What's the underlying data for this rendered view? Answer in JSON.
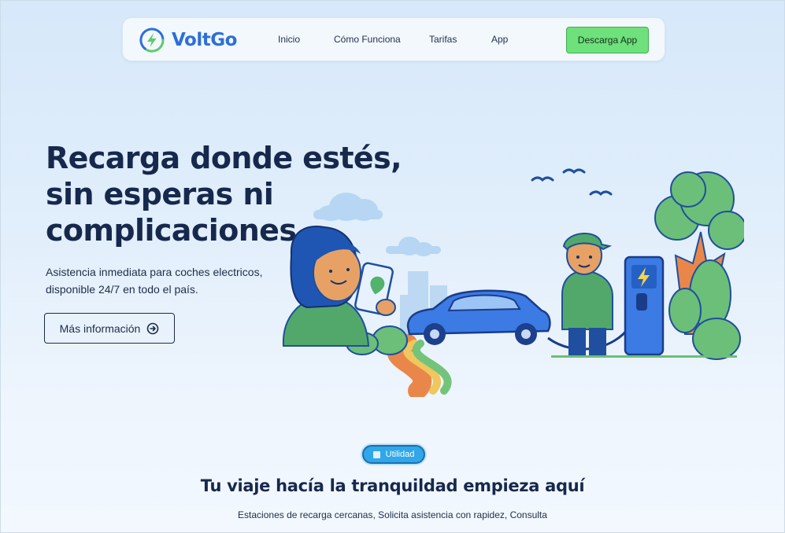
{
  "nav": {
    "brand": "VoltGo",
    "logo_icon": "lightning-bolt-icon",
    "links": [
      "Inicio",
      "Cómo Funciona",
      "Tarifas",
      "App"
    ],
    "cta": "Descarga App"
  },
  "hero": {
    "title_lines": [
      "Recarga donde estés,",
      "sin esperas ni",
      "complicaciones"
    ],
    "subtitle_lines": [
      "Asistencia inmediata para coches electricos,",
      "disponible 24/7 en todo el país."
    ],
    "button": "Más información",
    "button_icon": "arrow-right-circle-icon"
  },
  "section": {
    "badge": "Utilidad",
    "title": "Tu viaje hacía la tranquildad empieza aquí",
    "subtitle": "Estaciones de recarga cercanas, Solicita asistencia con rapidez, Consulta"
  },
  "colors": {
    "brand_blue": "#2d6fd9",
    "cta_green": "#6ee07c",
    "text_dark": "#17284d",
    "badge_blue": "#2fa7e8"
  }
}
